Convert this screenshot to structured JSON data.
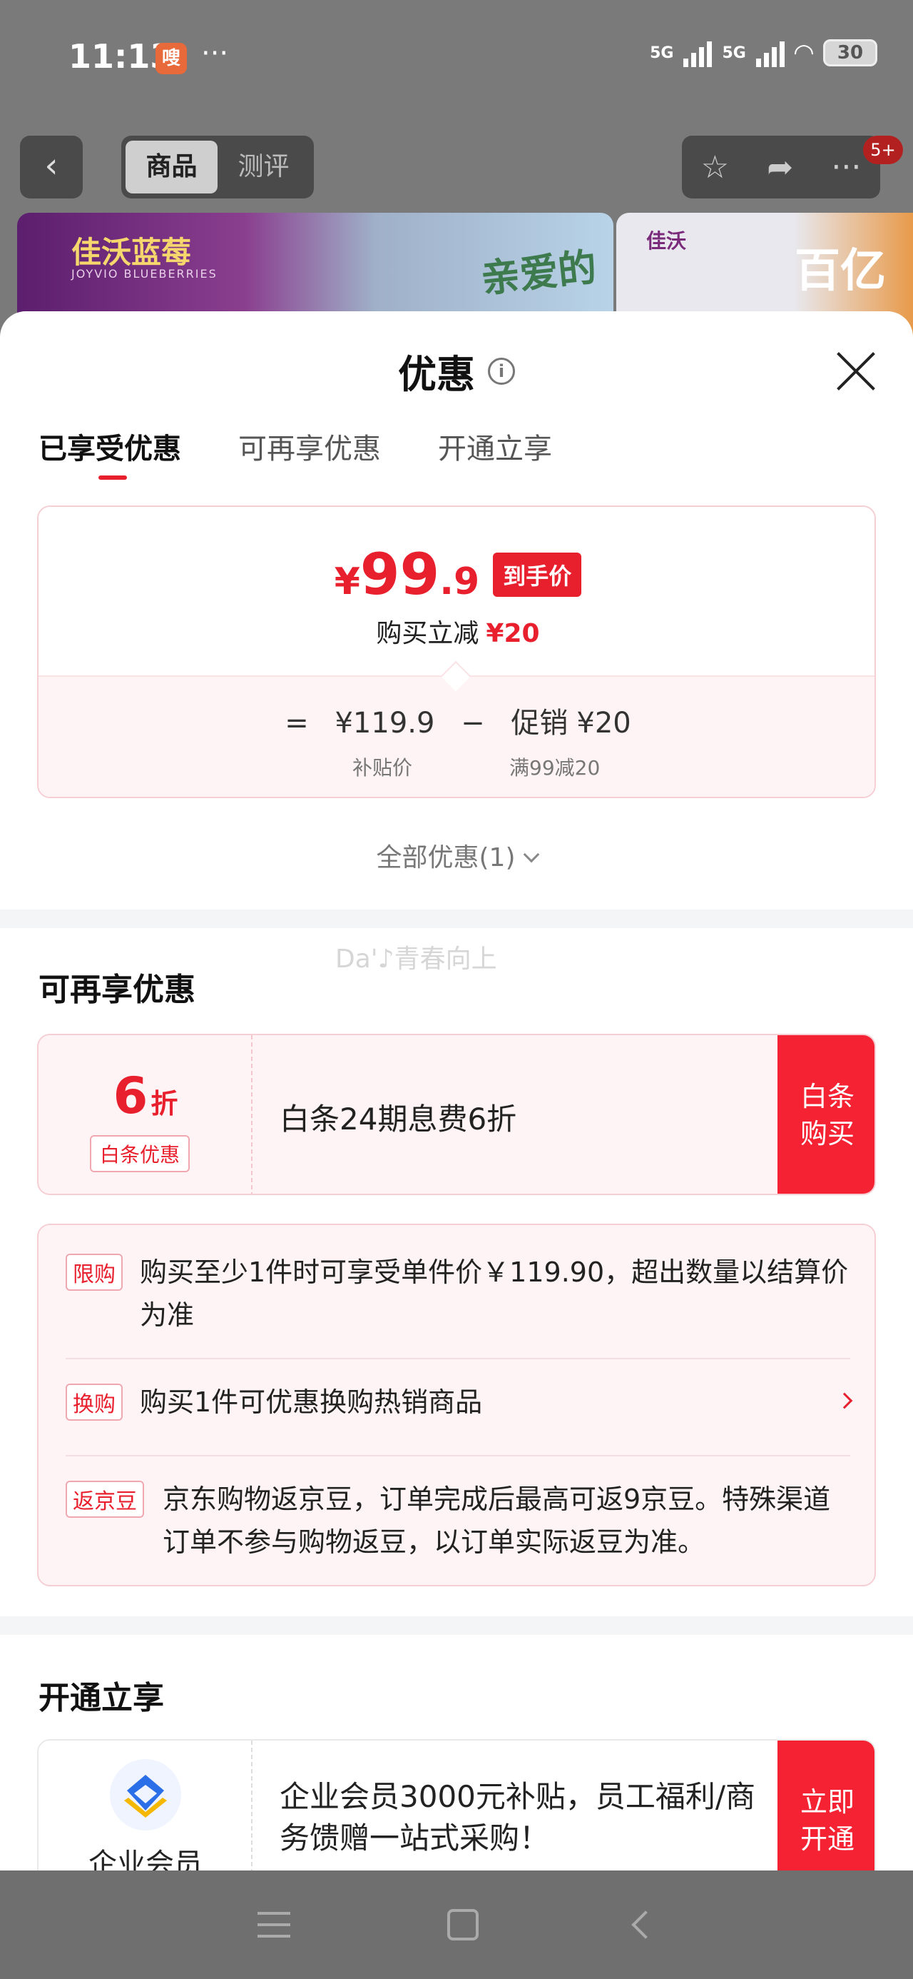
{
  "status": {
    "time": "11:13",
    "app_badge": "嗖",
    "dots": "···",
    "net1": "5G",
    "net2": "5G",
    "battery": "30"
  },
  "nav": {
    "back": "‹",
    "tabs": [
      "商品",
      "测评"
    ],
    "badge": "5+"
  },
  "banners": {
    "b1_brand": "佳沃蓝莓",
    "b1_sub": "JOYVIO BLUEBERRIES",
    "b1_art": "亲爱的",
    "b2_brand": "佳沃",
    "b2_art": "百亿"
  },
  "sheet": {
    "title": "优惠",
    "info_icon": "i",
    "tabs": [
      "已享受优惠",
      "可再享优惠",
      "开通立享"
    ]
  },
  "price": {
    "yen": "¥",
    "int": "99",
    "dec": ".9",
    "tag": "到手价",
    "sub_label": "购买立减",
    "sub_value": "¥20",
    "eq": "=",
    "base_price": "¥119.9",
    "minus": "−",
    "promo_label": "促销",
    "promo_value": "¥20",
    "base_label": "补贴价",
    "promo_desc": "满99减20"
  },
  "all_deals": "全部优惠(1)",
  "watermark": "Da'♪青春向上",
  "reenjoy": {
    "title": "可再享优惠",
    "coupon": {
      "num": "6",
      "unit": "折",
      "tag": "白条优惠",
      "text": "白条24期息费6折",
      "btn_line1": "白条",
      "btn_line2": "购买"
    }
  },
  "rules": [
    {
      "tag": "限购",
      "text": "购买至少1件时可享受单件价￥119.90，超出数量以结算价为准"
    },
    {
      "tag": "换购",
      "text": "购买1件可优惠换购热销商品"
    },
    {
      "tag": "返京豆",
      "text": "京东购物返京豆，订单完成后最高可返9京豆。特殊渠道订单不参与购物返豆，以订单实际返豆为准。"
    }
  ],
  "open": {
    "title": "开通立享",
    "member": {
      "name": "企业会员",
      "text": "企业会员3000元补贴，员工福利/商务馈赠一站式采购！",
      "btn_line1": "立即",
      "btn_line2": "开通"
    }
  }
}
